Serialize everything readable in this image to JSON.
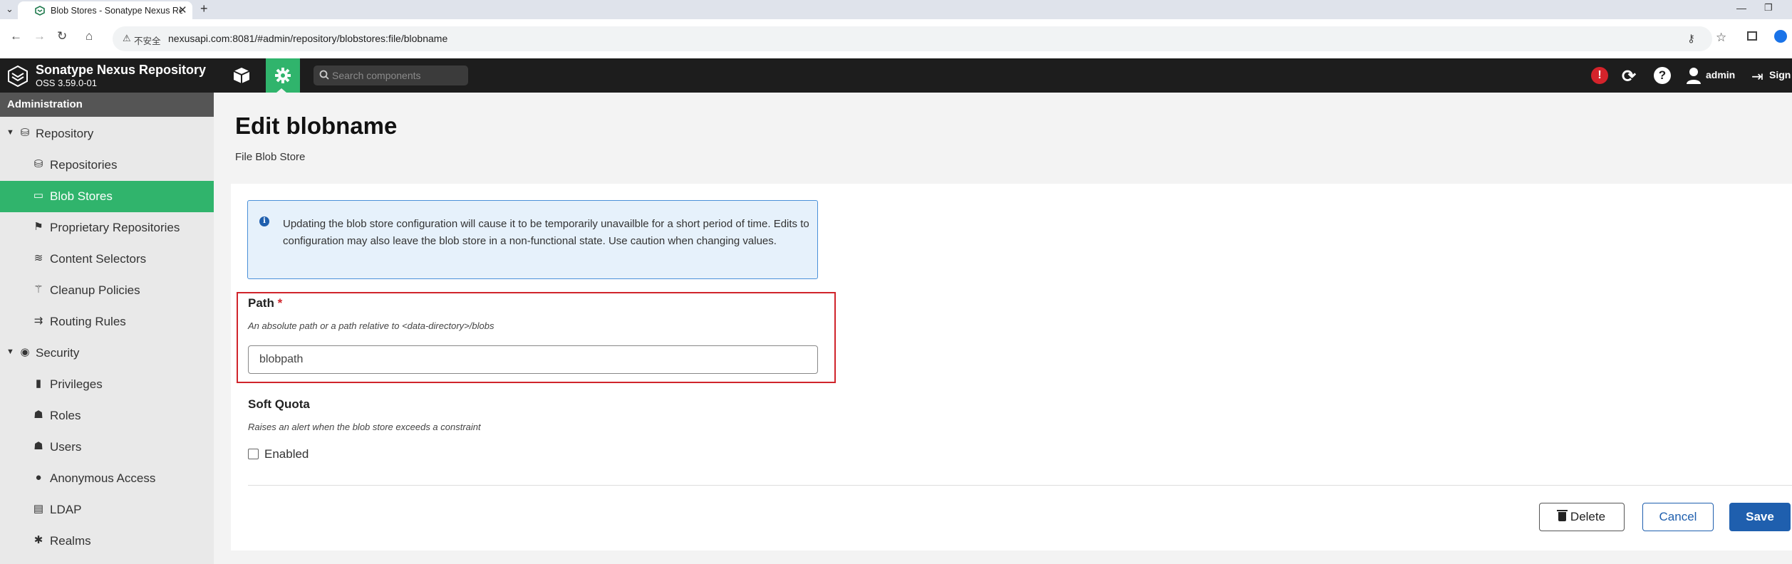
{
  "browser": {
    "tab_title": "Blob Stores - Sonatype Nexus Repository",
    "tab_close": "✕",
    "new_tab": "+",
    "insecure_label": "不安全",
    "url": "nexusapi.com:8081/#admin/repository/blobstores:file/blobname"
  },
  "header": {
    "product": "Sonatype Nexus Repository",
    "version": "OSS 3.59.0-01",
    "search_placeholder": "Search components",
    "alert": "!",
    "help": "?",
    "user": "admin",
    "signout": "Sign out"
  },
  "sidebar": {
    "title": "Administration",
    "items": [
      {
        "label": "Repository",
        "icon": "database-icon",
        "level": 0,
        "expanded": true
      },
      {
        "label": "Repositories",
        "icon": "database-icon",
        "level": 1
      },
      {
        "label": "Blob Stores",
        "icon": "hard-drive-icon",
        "level": 1,
        "active": true
      },
      {
        "label": "Proprietary Repositories",
        "icon": "flag-icon",
        "level": 1
      },
      {
        "label": "Content Selectors",
        "icon": "layers-icon",
        "level": 1
      },
      {
        "label": "Cleanup Policies",
        "icon": "broom-icon",
        "level": 1
      },
      {
        "label": "Routing Rules",
        "icon": "signpost-icon",
        "level": 1
      },
      {
        "label": "Security",
        "icon": "eye-icon",
        "level": 0,
        "expanded": true
      },
      {
        "label": "Privileges",
        "icon": "medal-icon",
        "level": 1
      },
      {
        "label": "Roles",
        "icon": "users-icon",
        "level": 1
      },
      {
        "label": "Users",
        "icon": "user-group-icon",
        "level": 1
      },
      {
        "label": "Anonymous Access",
        "icon": "user-icon",
        "level": 1
      },
      {
        "label": "LDAP",
        "icon": "book-icon",
        "level": 1
      },
      {
        "label": "Realms",
        "icon": "realm-icon",
        "level": 1
      }
    ]
  },
  "main": {
    "title": "Edit blobname",
    "subtitle": "File Blob Store",
    "info": "Updating the blob store configuration will cause it to be temporarily unavailble for a short period of time. Edits to configuration may also leave the blob store in a non-functional state. Use caution when changing values.",
    "path": {
      "label": "Path",
      "required": "*",
      "description": "An absolute path or a path relative to <data-directory>/blobs",
      "value": "blobpath"
    },
    "soft_quota": {
      "label": "Soft Quota",
      "description": "Raises an alert when the blob store exceeds a constraint",
      "checkbox_label": "Enabled",
      "checked": false
    },
    "buttons": {
      "delete": "Delete",
      "cancel": "Cancel",
      "save": "Save"
    }
  },
  "colors": {
    "accent_green": "#30b46c",
    "primary_blue": "#1f5fae",
    "error_red": "#d0242b",
    "header_dark": "#1d1d1d"
  }
}
